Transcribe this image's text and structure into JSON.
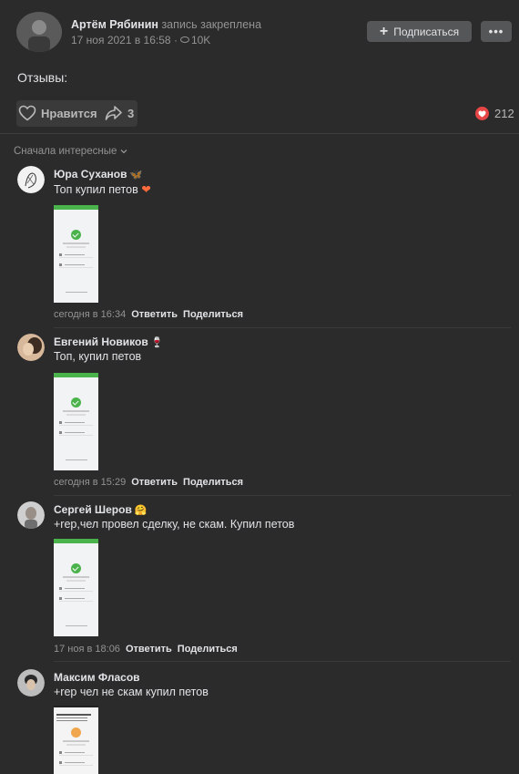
{
  "post": {
    "author_name": "Артём Рябинин",
    "author_note": "запись закреплена",
    "date": "17 ноя 2021 в 16:58",
    "views": "10K",
    "subscribe_label": "Подписаться",
    "more_label": "•••",
    "text": "Отзывы:",
    "like_label": "Нравится",
    "share_count": "3",
    "reactions_count": "212"
  },
  "sort": {
    "label": "Сначала интересные"
  },
  "comments": [
    {
      "name": "Юра Суханов",
      "emoji": "🦋",
      "text": "Топ купил петов",
      "text_emoji": "❤",
      "time": "сегодня в 16:34",
      "reply": "Ответить",
      "share": "Поделиться"
    },
    {
      "name": "Евгений Новиков",
      "emoji": "🍷",
      "text": "Топ, купил петов",
      "time": "сегодня в 15:29",
      "reply": "Ответить",
      "share": "Поделиться"
    },
    {
      "name": "Сергей Шеров",
      "emoji": "🤗",
      "text": "+rep,чел провел сделку, не скам. Купил петов",
      "time": "17 ноя в 18:06",
      "reply": "Ответить",
      "share": "Поделиться"
    },
    {
      "name": "Максим Фласов",
      "text": "+rep чел не скам купил петов"
    }
  ],
  "colors": {
    "background": "#2b2b2c",
    "accent_red": "#e64646",
    "button_bg": "#555657",
    "success_green": "#4bb34b"
  }
}
